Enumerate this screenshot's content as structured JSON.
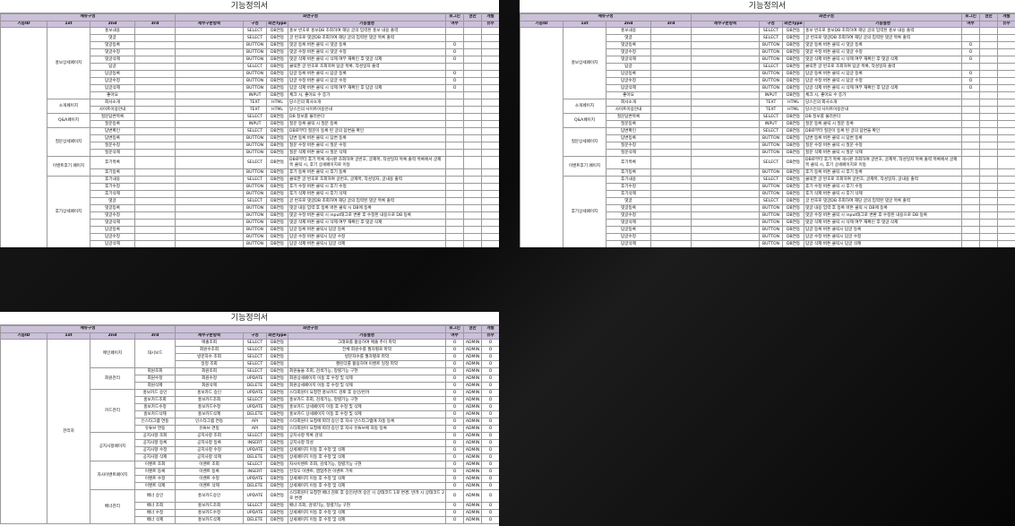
{
  "headers": {
    "group_menu": "메뉴구성",
    "group_screen": "화면구성",
    "login": "로그인",
    "auth": "권한",
    "dev": "개발",
    "func_id": "기능ID",
    "first": "1st",
    "second": "2nd",
    "third": "3rd",
    "detail": "세부구분항목",
    "comp": "구성",
    "screen_type": "화면Type",
    "desc": "기능설명",
    "login_sub": "여부",
    "dev_sub": "유무"
  },
  "sheets": [
    {
      "title": "기능정의서",
      "groups": [
        {
          "name": "홍보상세페이지",
          "rows": [
            {
              "second": "홍보내용",
              "comp": "SELECT",
              "type": "DB연동",
              "desc": "홍보 번호로 홍보DB 조회하여 해당 글의 입력된 홍보 내용 출력",
              "login": ""
            },
            {
              "second": "댓글",
              "comp": "SELECT",
              "type": "DB연동",
              "desc": "글 번호로 댓글DB 조회하여 해당 글의 입력된 댓글 목록 출력",
              "login": ""
            },
            {
              "second": "댓글등록",
              "comp": "BUTTON",
              "type": "DB연동",
              "desc": "댓글 등록 버튼 클릭 시 댓글 등록",
              "login": "O"
            },
            {
              "second": "댓글수정",
              "comp": "BUTTON",
              "type": "DB연동",
              "desc": "댓글 수정 버튼 클릭 시 댓글 수정",
              "login": "O"
            },
            {
              "second": "댓글삭제",
              "comp": "BUTTON",
              "type": "DB연동",
              "desc": "댓글 삭제 버튼 클릭 시 삭제 여부 재확인 후 댓글 삭제",
              "login": "O"
            },
            {
              "second": "답글",
              "comp": "SELECT",
              "type": "DB연동",
              "desc": "클릭한 글 번호로 조회하여 답글 목록, 작성일자 출력",
              "login": ""
            },
            {
              "second": "답글등록",
              "comp": "BUTTON",
              "type": "DB연동",
              "desc": "답글 등록 버튼 클릭 시 답글 등록",
              "login": "O"
            },
            {
              "second": "답글수정",
              "comp": "BUTTON",
              "type": "DB연동",
              "desc": "답글 수정 버튼 클릭 시 답글 수정",
              "login": "O"
            },
            {
              "second": "답글삭제",
              "comp": "BUTTON",
              "type": "DB연동",
              "desc": "답글 삭제 버튼 클릭 시 삭제 여부 재확인 후 답글 삭제",
              "login": "O"
            },
            {
              "second": "좋아요",
              "comp": "INPUT",
              "type": "DB연동",
              "desc": "체크 시, 좋아요 수 증가",
              "login": ""
            }
          ]
        },
        {
          "name": "소개페이지",
          "rows": [
            {
              "second": "회사소개",
              "comp": "TEXT",
              "type": "HTML",
              "desc": "당스인의 회사소개",
              "login": ""
            },
            {
              "second": "사이트이용안내",
              "comp": "TEXT",
              "type": "HTML",
              "desc": "당스인의 사이트이용안내",
              "login": ""
            }
          ]
        },
        {
          "name": "Q&A페이지",
          "rows": [
            {
              "second": "질문답변목록",
              "comp": "SELECT",
              "type": "DB연동",
              "desc": "DB 정보를 불러온다",
              "login": ""
            },
            {
              "second": "질문등록",
              "comp": "INPUT",
              "type": "DB연동",
              "desc": "질문 등록 클릭 시 질문 등록",
              "login": ""
            }
          ]
        },
        {
          "name": "질문상세페이지",
          "rows": [
            {
              "second": "답변확인",
              "comp": "SELECT",
              "type": "DB연동",
              "desc": "DB로부터 질문이 등록 된 글의 답변을 확인",
              "login": ""
            },
            {
              "second": "답변등록",
              "comp": "BUTTON",
              "type": "DB연동",
              "desc": "답변 등록 버튼 클릭 시 답변 등록",
              "login": ""
            },
            {
              "second": "질문수정",
              "comp": "BUTTON",
              "type": "DB연동",
              "desc": "질문 수정 버튼 클릭 시 질문 수정",
              "login": ""
            },
            {
              "second": "질문삭제",
              "comp": "BUTTON",
              "type": "DB연동",
              "desc": "질문 삭제 버튼 클릭 시 질문 삭제",
              "login": ""
            }
          ]
        },
        {
          "name": "이벤트후기 페이지",
          "rows": [
            {
              "second": "후기목록",
              "comp": "SELECT",
              "type": "DB연동",
              "desc": "DB로부터 후기 목록 게시판 조회하여 글번호, 글제목, 작성일자 목록 출력 목록에서 글제목 클릭 시, 후기 상세페이지로 이동",
              "login": ""
            },
            {
              "second": "후기등록",
              "comp": "BUTTON",
              "type": "DB연동",
              "desc": "후기 등록 버튼 클릭 시 후기 등록",
              "login": ""
            }
          ]
        },
        {
          "name": "후기상세페이지",
          "rows": [
            {
              "second": "후기내용",
              "comp": "SELECT",
              "type": "DB연동",
              "desc": "클릭한 글 번호로 조회하여 글번호, 글제목, 작성일자, 글내용 출력",
              "login": ""
            },
            {
              "second": "후기수정",
              "comp": "BUTTON",
              "type": "DB연동",
              "desc": "후기 수정 버튼 클릭 시 후기 수정",
              "login": ""
            },
            {
              "second": "후기삭제",
              "comp": "BUTTON",
              "type": "DB연동",
              "desc": "후기 삭제 버튼 클릭 시 후기 삭제",
              "login": ""
            },
            {
              "second": "댓글",
              "comp": "SELECT",
              "type": "DB연동",
              "desc": "글 번호로 댓글DB 조회하여 해당 글의 입력된 댓글 목록 출력",
              "login": ""
            },
            {
              "second": "댓글등록",
              "comp": "BUTTON",
              "type": "DB연동",
              "desc": "댓글 내용 입력 후 등록 버튼 클릭 시 DB에 등록",
              "login": ""
            },
            {
              "second": "댓글수정",
              "comp": "BUTTON",
              "type": "DB연동",
              "desc": "댓글 수정 버튼 클릭 시 input태그로 변환 후 수정된 내용으로 DB 등록",
              "login": ""
            },
            {
              "second": "댓글삭제",
              "comp": "BUTTON",
              "type": "DB연동",
              "desc": "댓글 삭제 버튼 클릭 시 삭제 여부 재확인 후 댓글 삭제",
              "login": ""
            },
            {
              "second": "답글등록",
              "comp": "BUTTON",
              "type": "DB연동",
              "desc": "답글 등록 버튼 클릭시 답글 등록",
              "login": ""
            },
            {
              "second": "답글수정",
              "comp": "BUTTON",
              "type": "DB연동",
              "desc": "답글 수정 버튼 클릭시 답글 수정",
              "login": ""
            },
            {
              "second": "답글삭제",
              "comp": "BUTTON",
              "type": "DB연동",
              "desc": "답글 삭제 버튼 클릭시 답글 삭제",
              "login": ""
            }
          ]
        }
      ]
    },
    {
      "title": "기능정의서",
      "first": "관리자",
      "groups": [
        {
          "name": "메인페이지",
          "subgroups": [
            {
              "third": "대시보드",
              "rows": [
                {
                  "detail": "매출조회",
                  "comp": "SELECT",
                  "type": "DB연동",
                  "desc": "그래프를 활용하여 매출 추이 파악",
                  "center": true
                },
                {
                  "detail": "회원수조회",
                  "comp": "SELECT",
                  "type": "DB연동",
                  "desc": "전체 회원수를 월차별로 파악",
                  "center": true
                },
                {
                  "detail": "방문자수 조회",
                  "comp": "SELECT",
                  "type": "DB연동",
                  "desc": "방문자수를 월차별로 파악",
                  "center": true
                },
                {
                  "detail": "일정 조회",
                  "comp": "SELECT",
                  "type": "DB연동",
                  "desc": "캘린더를 활용하여 이벤트 일정 파악",
                  "center": true
                }
              ]
            }
          ]
        },
        {
          "name": "회원관리",
          "subgroups": [
            {
              "third": "",
              "rows": [
                {
                  "mid": "회원조회",
                  "detail": "회원조회",
                  "comp": "SELECT",
                  "type": "DB연동",
                  "desc": "회원들을 조회, 검색기능, 정렬기능 구현"
                },
                {
                  "mid": "회원수정",
                  "detail": "회원수정",
                  "comp": "UPDATE",
                  "type": "DB연동",
                  "desc": "회원상세페이지 이동 후 수정 및 삭제"
                },
                {
                  "mid": "회원삭제",
                  "detail": "회원삭제",
                  "comp": "DELETE",
                  "type": "DB연동",
                  "desc": "회원상세페이지 이동 후 수정 및 삭제"
                }
              ]
            }
          ]
        },
        {
          "name": "카드관리",
          "subgroups": [
            {
              "third": "",
              "rows": [
                {
                  "mid": "홍보카드 승인",
                  "detail": "홍보카드 승인",
                  "comp": "UPDATE",
                  "type": "DB연동",
                  "desc": "스타회원이 요청한 홍보카드 검토 후 승인/반려"
                },
                {
                  "mid": "홍보카드조회",
                  "detail": "홍보카드조회",
                  "comp": "SELECT",
                  "type": "DB연동",
                  "desc": "홍보카드 조회, 검색기능, 정렬기능 구현"
                },
                {
                  "mid": "홍보카드수정",
                  "detail": "홍보카드수정",
                  "comp": "UPDATE",
                  "type": "DB연동",
                  "desc": "홍보카드 상세페이지 이동 후 수정 및 삭제"
                },
                {
                  "mid": "홍보카드삭제",
                  "detail": "홍보카드삭제",
                  "comp": "DELETE",
                  "type": "DB연동",
                  "desc": "홍보카드 상세페이지 이동 후 수정 및 삭제"
                },
                {
                  "mid": "인스타그램 연동",
                  "detail": "인스타그램 연동",
                  "comp": "API",
                  "type": "DB연동",
                  "desc": "스타회원이 요청에 따라 승인 후 자사 인스타그램에 자동 등록"
                },
                {
                  "mid": "유튜브 연동",
                  "detail": "유튜브 연동",
                  "comp": "API",
                  "type": "DB연동",
                  "desc": "스타회원이 요청에 따라 승인 후 자사 유튜브에 자동 등록"
                }
              ]
            }
          ]
        },
        {
          "name": "공지사항페이지",
          "subgroups": [
            {
              "third": "",
              "rows": [
                {
                  "mid": "공지사항 조회",
                  "detail": "공지사항 조회",
                  "comp": "SELECT",
                  "type": "DB연동",
                  "desc": "공지사항 목록 검색"
                },
                {
                  "mid": "공지사항 등록",
                  "detail": "공지사항 등록",
                  "comp": "INSERT",
                  "type": "DB연동",
                  "desc": "공지사항 작성"
                },
                {
                  "mid": "공지사항 수정",
                  "detail": "공지사항 수정",
                  "comp": "UPDATE",
                  "type": "DB연동",
                  "desc": "상세페이지 이동 후 수정 및 삭제"
                },
                {
                  "mid": "공지사항 삭제",
                  "detail": "공지사항 삭제",
                  "comp": "DELETE",
                  "type": "DB연동",
                  "desc": "상세페이지 이동 후 수정 및 삭제"
                }
              ]
            }
          ]
        },
        {
          "name": "자사이벤트페이지",
          "subgroups": [
            {
              "third": "",
              "rows": [
                {
                  "mid": "이벤트 조회",
                  "detail": "이벤트 조회",
                  "comp": "SELECT",
                  "type": "DB연동",
                  "desc": "자사이벤트 조회, 검색기능, 정렬기능 구현"
                },
                {
                  "mid": "이벤트 등록",
                  "detail": "이벤트 등록",
                  "comp": "INSERT",
                  "type": "DB연동",
                  "desc": "신작오 이벤트, 앱업추천 이벤트 기획"
                },
                {
                  "mid": "이벤트 수정",
                  "detail": "이벤트 수정",
                  "comp": "UPDATE",
                  "type": "DB연동",
                  "desc": "상세페이지 이동 후 수정 및 삭제"
                },
                {
                  "mid": "이벤트 삭제",
                  "detail": "이벤트 삭제",
                  "comp": "DELETE",
                  "type": "DB연동",
                  "desc": "상세페이지 이동 후 수정 및 삭제"
                }
              ]
            }
          ]
        },
        {
          "name": "배너관리",
          "subgroups": [
            {
              "third": "",
              "rows": [
                {
                  "mid": "배너 승인",
                  "detail": "홍보카드승인",
                  "comp": "UPDATE",
                  "type": "DB연동",
                  "desc": "스타회원이 요청한 배너 검토 후 승인/반려 승인 시 상태코드 1로 변경, 반려 시 상태코드 2로 변경",
                  "tall": true
                },
                {
                  "mid": "배너 조회",
                  "detail": "홍보카드조회",
                  "comp": "SELECT",
                  "type": "DB연동",
                  "desc": "배너 조회, 검색기능, 정렬기능 구현"
                },
                {
                  "mid": "배너 수정",
                  "detail": "홍보카드수정",
                  "comp": "UPDATE",
                  "type": "DB연동",
                  "desc": "상세페이지 이동 후 수정 및 삭제"
                },
                {
                  "mid": "배너 삭제",
                  "detail": "홍보카드삭제",
                  "comp": "DELETE",
                  "type": "DB연동",
                  "desc": "상세페이지 이동 후 수정 및 삭제"
                }
              ]
            }
          ]
        }
      ],
      "login_value": "O",
      "auth_value": "ADMIN",
      "dev_value": "O"
    }
  ]
}
